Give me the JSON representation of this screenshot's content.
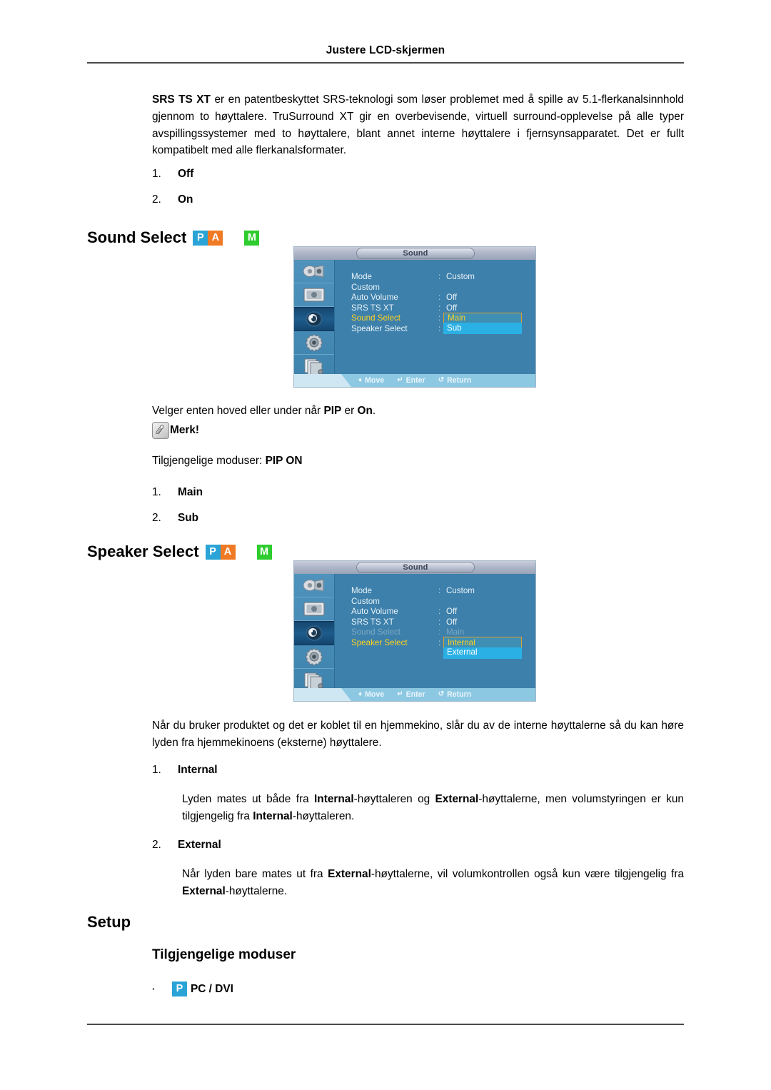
{
  "page": {
    "running_header": "Justere LCD-skjermen"
  },
  "intro": {
    "paragraph_lead": "SRS TS XT",
    "paragraph_rest": " er en patentbeskyttet SRS-teknologi som løser problemet med å spille av 5.1-flerkanalsinnhold gjennom to høyttalere. TruSurround XT gir en overbevisende, virtuell surround-opplevelse på alle typer avspillingssystemer med to høyttalere, blant annet interne høyttalere i fjernsynsapparatet. Det er fullt kompatibelt med alle flerkanalsformater.",
    "options": [
      {
        "num": "1.",
        "label": "Off"
      },
      {
        "num": "2.",
        "label": "On"
      }
    ]
  },
  "sound_select": {
    "heading": "Sound Select",
    "badges": [
      {
        "name": "badge-pc",
        "letter": "P",
        "color": "#2aa3d6"
      },
      {
        "name": "badge-av",
        "letter": "A",
        "color": "#f07a24"
      },
      {
        "name": "badge-mode-m",
        "letter": "M",
        "color": "#2ecc2e"
      }
    ],
    "description_pre": "Velger enten hoved eller under når ",
    "description_bold1": "PIP",
    "description_mid": " er ",
    "description_bold2": "On",
    "description_post": ".",
    "note_label": "Merk!",
    "modes_label": "Tilgjengelige moduser: ",
    "modes_value": "PIP ON",
    "options": [
      {
        "num": "1.",
        "label": "Main"
      },
      {
        "num": "2.",
        "label": "Sub"
      }
    ],
    "osd": {
      "title": "Sound",
      "sidebar_icons": [
        "input-source-icon",
        "picture-display-icon",
        "sound-speaker-icon",
        "setup-gear-icon",
        "multi-control-pages-icon"
      ],
      "selected_sidebar_index": 2,
      "rows": [
        {
          "label": "Mode",
          "colon": ":",
          "value": "Custom",
          "state": "normal"
        },
        {
          "label": "Custom",
          "colon": "",
          "value": "",
          "state": "normal"
        },
        {
          "label": "Auto Volume",
          "colon": ":",
          "value": "Off",
          "state": "normal"
        },
        {
          "label": "SRS TS XT",
          "colon": ":",
          "value": "Off",
          "state": "normal"
        },
        {
          "label": "Sound Select",
          "colon": ":",
          "value": "Main",
          "state": "active-boxed"
        },
        {
          "label": "Speaker Select",
          "colon": ":",
          "value": "Sub",
          "state": "highlight"
        }
      ],
      "hints": [
        {
          "icon": "move-arrows-icon",
          "label": "Move",
          "glyph": "♦"
        },
        {
          "icon": "enter-button-icon",
          "label": "Enter",
          "glyph": "↵"
        },
        {
          "icon": "return-arrow-icon",
          "label": "Return",
          "glyph": "↺"
        }
      ]
    }
  },
  "speaker_select": {
    "heading": "Speaker Select",
    "badges": [
      {
        "name": "badge-pc",
        "letter": "P",
        "color": "#2aa3d6"
      },
      {
        "name": "badge-av",
        "letter": "A",
        "color": "#f07a24"
      },
      {
        "name": "badge-mode-m",
        "letter": "M",
        "color": "#2ecc2e"
      }
    ],
    "description": "Når du bruker produktet og det er koblet til en hjemmekino, slår du av de interne høyttalerne så du kan høre lyden fra hjemmekinoens (eksterne) høyttalere.",
    "option1_num": "1.",
    "option1_label": "Internal",
    "option1_text_pre": "Lyden mates ut både fra ",
    "option1_text_b1": "Internal",
    "option1_text_mid": "-høyttaleren og ",
    "option1_text_b2": "External",
    "option1_text_mid2": "-høyttalerne, men volumstyringen er kun tilgjengelig fra ",
    "option1_text_b3": "Internal",
    "option1_text_post": "-høyttaleren.",
    "option2_num": "2.",
    "option2_label": "External",
    "option2_text_pre": "Når lyden bare mates ut fra ",
    "option2_text_b1": "External",
    "option2_text_mid": "-høyttalerne, vil volumkontrollen også kun være tilgjengelig fra ",
    "option2_text_b2": "External",
    "option2_text_post": "-høyttalerne.",
    "osd": {
      "title": "Sound",
      "sidebar_icons": [
        "input-source-icon",
        "picture-display-icon",
        "sound-speaker-icon",
        "setup-gear-icon",
        "multi-control-pages-icon"
      ],
      "selected_sidebar_index": 2,
      "rows": [
        {
          "label": "Mode",
          "colon": ":",
          "value": "Custom",
          "state": "normal"
        },
        {
          "label": "Custom",
          "colon": "",
          "value": "",
          "state": "normal"
        },
        {
          "label": "Auto Volume",
          "colon": ":",
          "value": "Off",
          "state": "normal"
        },
        {
          "label": "SRS TS XT",
          "colon": ":",
          "value": "Off",
          "state": "normal"
        },
        {
          "label": "Sound Select",
          "colon": ":",
          "value": "Main",
          "state": "dim"
        },
        {
          "label": "Speaker Select",
          "colon": ":",
          "value": "Internal",
          "state": "active-boxed"
        },
        {
          "label": "",
          "colon": "",
          "value": "External",
          "state": "highlight"
        }
      ],
      "hints": [
        {
          "icon": "move-arrows-icon",
          "label": "Move",
          "glyph": "♦"
        },
        {
          "icon": "enter-button-icon",
          "label": "Enter",
          "glyph": "↵"
        },
        {
          "icon": "return-arrow-icon",
          "label": "Return",
          "glyph": "↺"
        }
      ]
    }
  },
  "setup": {
    "heading": "Setup",
    "sub_heading": "Tilgjengelige moduser",
    "bullet_dot": "·",
    "bullet_badge_letter": "P",
    "bullet_label": "PC / DVI"
  }
}
